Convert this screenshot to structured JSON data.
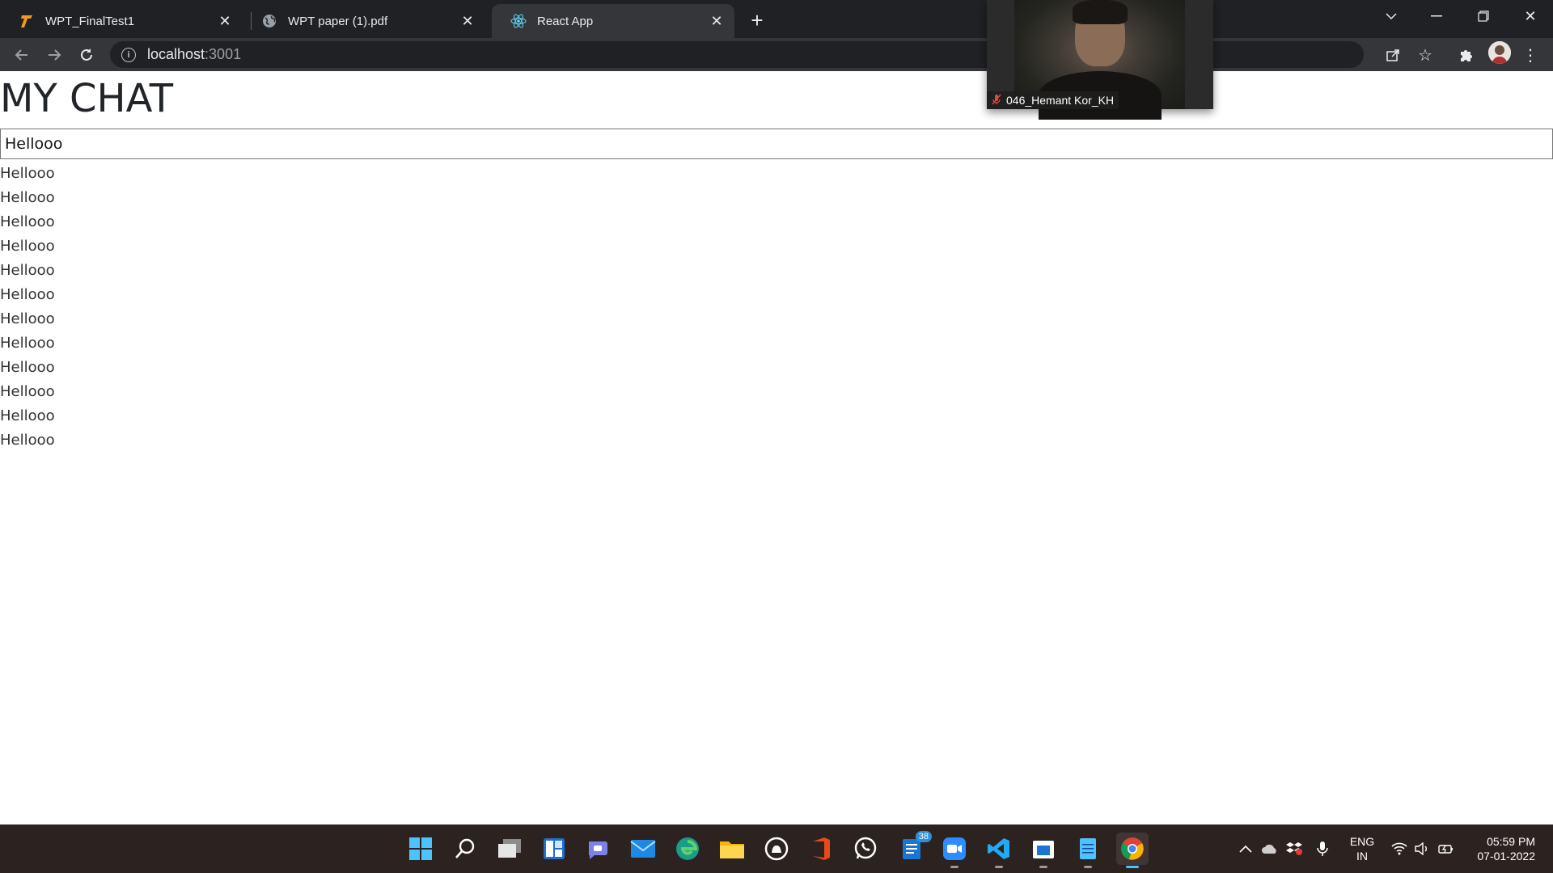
{
  "browser": {
    "tabs": [
      {
        "title": "WPT_FinalTest1",
        "active": false
      },
      {
        "title": "WPT paper (1).pdf",
        "active": false
      },
      {
        "title": "React App",
        "active": true
      }
    ],
    "url_host": "localhost",
    "url_port": ":3001"
  },
  "page": {
    "title": "MY CHAT",
    "input_value": "Hellooo",
    "messages": [
      "Hellooo",
      "Hellooo",
      "Hellooo",
      "Hellooo",
      "Hellooo",
      "Hellooo",
      "Hellooo",
      "Hellooo",
      "Hellooo",
      "Hellooo",
      "Hellooo",
      "Hellooo"
    ]
  },
  "video_overlay": {
    "participant_name": "046_Hemant Kor_KH"
  },
  "taskbar": {
    "apps": [
      "start",
      "search",
      "task-view",
      "widgets",
      "chat",
      "mail",
      "edge",
      "file-explorer",
      "github",
      "office",
      "whatsapp",
      "todo",
      "zoom",
      "vscode",
      "store",
      "notepad",
      "chrome"
    ],
    "todo_badge": "38",
    "language_top": "ENG",
    "language_bottom": "IN",
    "time": "05:59 PM",
    "date": "07-01-2022"
  },
  "colors": {
    "tabstrip": "#202124",
    "toolbar": "#35363a",
    "taskbar": "#2c2220",
    "accent": "#4cc2ff"
  }
}
